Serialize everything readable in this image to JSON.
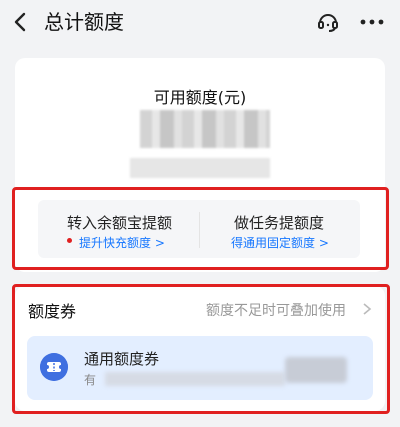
{
  "header": {
    "title": "总计额度",
    "icons": [
      "back-arrow-icon",
      "customer-service-icon",
      "more-icon"
    ]
  },
  "summary": {
    "title": "可用额度(元)"
  },
  "actions": [
    {
      "title": "转入余额宝提额",
      "subtitle": "提升快充额度 >"
    },
    {
      "title": "做任务提额度",
      "subtitle": "得通用固定额度 >"
    }
  ],
  "coupons": {
    "heading": "额度券",
    "hint": "额度不足时可叠加使用",
    "item": {
      "name": "通用额度券",
      "desc_prefix": "有"
    }
  },
  "colors": {
    "accent_blue": "#1677ff",
    "highlight_red": "#e02020",
    "coupon_bg": "#e3eeff"
  }
}
